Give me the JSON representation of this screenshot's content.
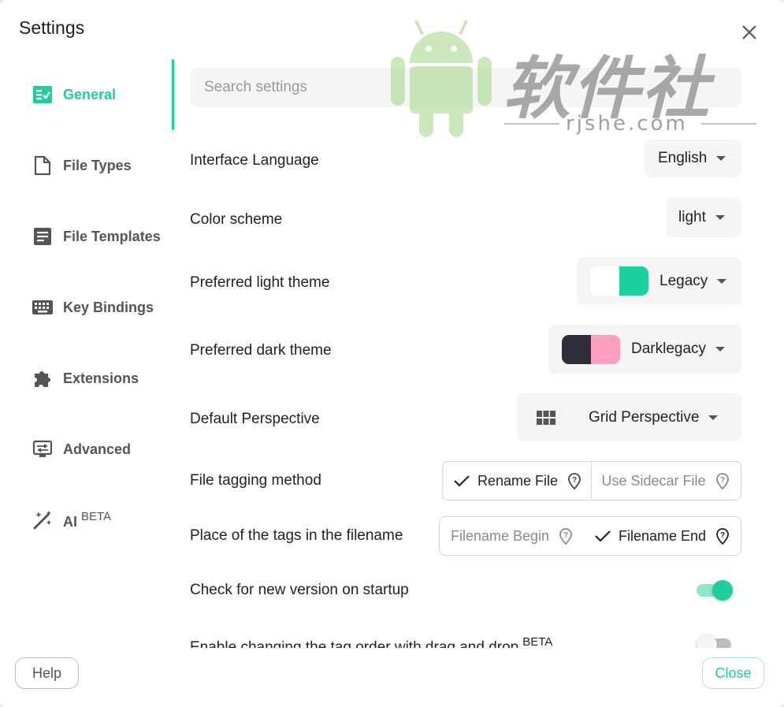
{
  "dialog": {
    "title": "Settings"
  },
  "nav": {
    "items": [
      {
        "label": "General",
        "icon": "checklist-icon"
      },
      {
        "label": "File Types",
        "icon": "file-icon"
      },
      {
        "label": "File Templates",
        "icon": "article-icon"
      },
      {
        "label": "Key Bindings",
        "icon": "keyboard-icon"
      },
      {
        "label": "Extensions",
        "icon": "puzzle-icon"
      },
      {
        "label": "Advanced",
        "icon": "settings-display-icon"
      },
      {
        "label": "AI",
        "icon": "magic-wand-icon",
        "badge": "BETA"
      }
    ]
  },
  "search": {
    "placeholder": "Search settings"
  },
  "settings": {
    "interface_language": {
      "label": "Interface Language",
      "value": "English"
    },
    "color_scheme": {
      "label": "Color scheme",
      "value": "light"
    },
    "light_theme": {
      "label": "Preferred light theme",
      "value": "Legacy",
      "colors": [
        "#ffffff",
        "#1dd19f"
      ]
    },
    "dark_theme": {
      "label": "Preferred dark theme",
      "value": "Darklegacy",
      "colors": [
        "#2c2f3a",
        "#ff9dbf"
      ]
    },
    "perspective": {
      "label": "Default Perspective",
      "value": "Grid Perspective",
      "icon": "grid-icon"
    },
    "tagging_method": {
      "label": "File tagging method",
      "options": [
        "Rename File",
        "Use Sidecar File"
      ],
      "selected": "Rename File"
    },
    "tag_place": {
      "label": "Place of the tags in the filename",
      "options": [
        "Filename Begin",
        "Filename End"
      ],
      "selected": "Filename End"
    },
    "check_version": {
      "label": "Check for new version on startup",
      "enabled": true
    },
    "tag_order_dnd": {
      "label": "Enable changing the tag order with drag and drop",
      "badge": "BETA",
      "enabled": false
    }
  },
  "footer": {
    "help_label": "Help",
    "close_label": "Close"
  },
  "colors": {
    "accent": "#1dcf9f",
    "muted": "#555555"
  },
  "watermark": {
    "brand": "软件社",
    "url": "rjshe.com"
  }
}
